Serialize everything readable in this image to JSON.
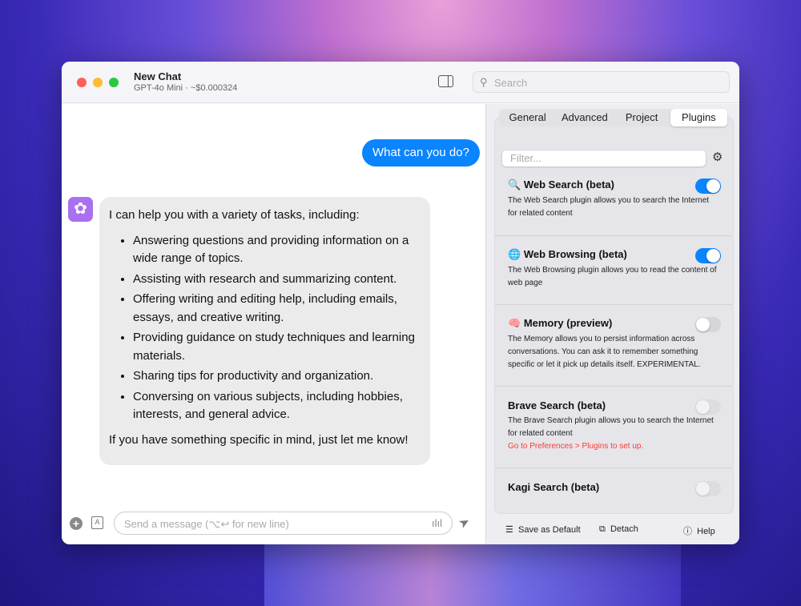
{
  "window": {
    "title": "New Chat",
    "subtitle": "GPT-4o Mini · ~$0.000324",
    "search_placeholder": "Search"
  },
  "chat": {
    "user_message": "What can you do?",
    "assistant": {
      "intro": "I can help you with a variety of tasks, including:",
      "items": [
        "Answering questions and providing information on a wide range of topics.",
        "Assisting with research and summarizing content.",
        "Offering writing and editing help, including emails, essays, and creative writing.",
        "Providing guidance on study techniques and learning materials.",
        "Sharing tips for productivity and organization.",
        "Conversing on various subjects, including hobbies, interests, and general advice."
      ],
      "outro": "If you have something specific in mind, just let me know!"
    },
    "input_placeholder": "Send a message (⌥↩ for new line)"
  },
  "panel": {
    "tabs": [
      "General",
      "Advanced",
      "Project",
      "Plugins"
    ],
    "active_tab": "Plugins",
    "filter_placeholder": "Filter...",
    "plugins": [
      {
        "icon": "🔍",
        "name": "Web Search (beta)",
        "desc": "The Web Search plugin allows you to search the Internet for related content",
        "enabled": true
      },
      {
        "icon": "🌐",
        "name": "Web Browsing (beta)",
        "desc": "The Web Browsing plugin allows you to read the content of web page",
        "enabled": true
      },
      {
        "icon": "🧠",
        "name": "Memory (preview)",
        "desc": "The Memory allows you to persist information across conversations. You can ask it to remember something specific or let it pick up details itself. EXPERIMENTAL.",
        "enabled": false
      },
      {
        "name": "Brave Search (beta)",
        "desc": "The Brave Search plugin allows you to search the Internet for related content",
        "warning": "Go to Preferences > Plugins to set up.",
        "enabled": false
      },
      {
        "name": "Kagi Search (beta)",
        "enabled": false
      }
    ],
    "footer": {
      "save_default": "Save as Default",
      "detach": "Detach",
      "help": "Help"
    }
  }
}
